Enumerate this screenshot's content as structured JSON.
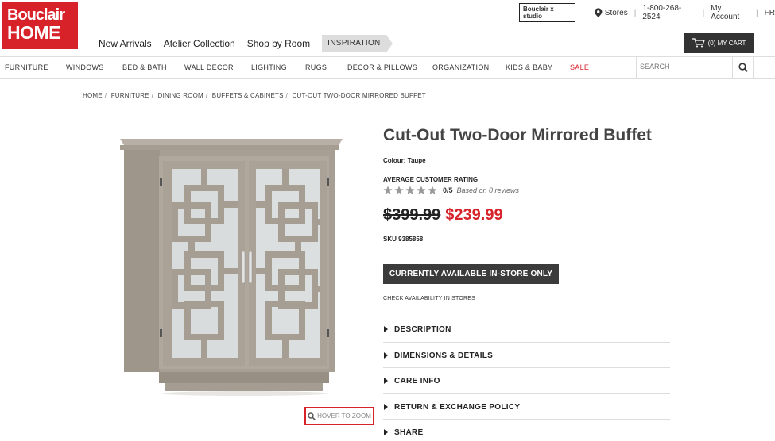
{
  "logo": {
    "line1": "Bouclair",
    "line2": "HOME"
  },
  "top_nav": [
    "New Arrivals",
    "Atelier Collection",
    "Shop by Room"
  ],
  "inspiration": "INSPIRATION",
  "utility": {
    "studio": "Bouclair x studio",
    "stores": "Stores",
    "phone": "1-800-268-2524",
    "account": "My Account",
    "lang": "FR"
  },
  "cart": {
    "label": "(0) MY CART"
  },
  "categories": [
    "FURNITURE",
    "WINDOWS",
    "BED & BATH",
    "WALL DECOR",
    "LIGHTING",
    "RUGS",
    "DECOR & PILLOWS",
    "ORGANIZATION",
    "KIDS & BABY",
    "SALE"
  ],
  "search": {
    "placeholder": "SEARCH"
  },
  "breadcrumb": [
    "HOME",
    "FURNITURE",
    "DINING ROOM",
    "BUFFETS & CABINETS",
    "CUT-OUT TWO-DOOR MIRRORED BUFFET"
  ],
  "product": {
    "title": "Cut-Out Two-Door Mirrored Buffet",
    "colour": "Colour: Taupe",
    "rating_label": "AVERAGE CUSTOMER RATING",
    "rating_score": "0/5",
    "rating_basis": "Based on 0 reviews",
    "rating_value": 0,
    "old_price": "$399.99",
    "new_price": "$239.99",
    "sku": "SKU 9385858",
    "instore_button": "CURRENTLY AVAILABLE IN-STORE ONLY",
    "check_stores": "CHECK AVAILABILITY IN STORES",
    "zoom_hint": "HOVER TO ZOOM"
  },
  "accordion": [
    "DESCRIPTION",
    "DIMENSIONS & DETAILS",
    "CARE INFO",
    "RETURN & EXCHANGE POLICY",
    "SHARE"
  ],
  "colors": {
    "brand_red": "#d7222a",
    "dark_button": "#3b3b3b",
    "cabinet": "#a79e94",
    "mirror": "#d9dcdc"
  }
}
